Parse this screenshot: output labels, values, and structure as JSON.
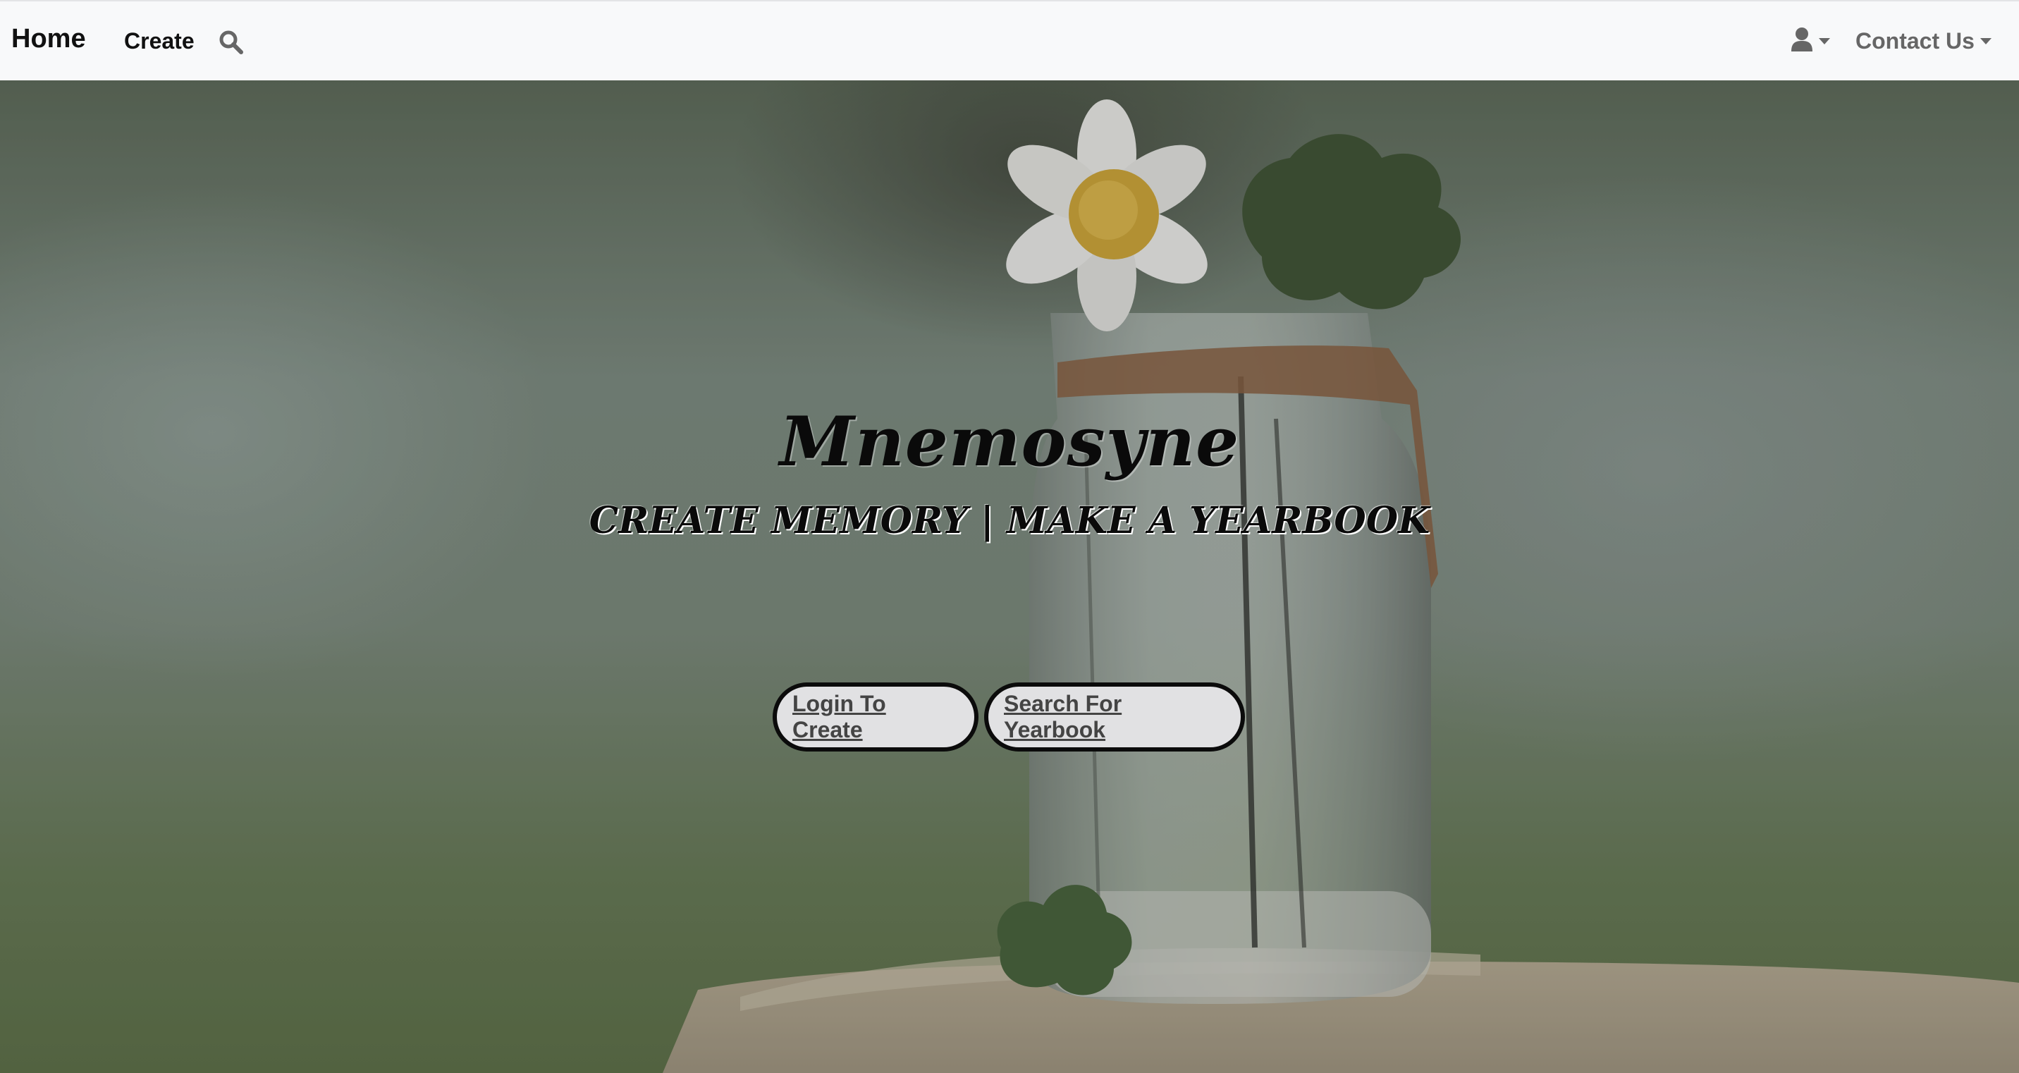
{
  "navbar": {
    "brand": "Home",
    "create_label": "Create",
    "search_icon": "search-icon",
    "user_icon": "user-icon",
    "contact_label": "Contact Us"
  },
  "hero": {
    "title": "Mnemosyne",
    "subtitle": "CREATE MEMORY | MAKE A YEARBOOK",
    "login_button": "Login To Create",
    "search_button": "Search For Yearbook",
    "background": "flower-in-glass-jar-photo"
  },
  "colors": {
    "navbar_bg": "#f8f9fa",
    "button_bg": "#e1e1e3",
    "button_border": "#0b0b0b",
    "text_dark": "#111111",
    "text_muted": "#666666"
  }
}
